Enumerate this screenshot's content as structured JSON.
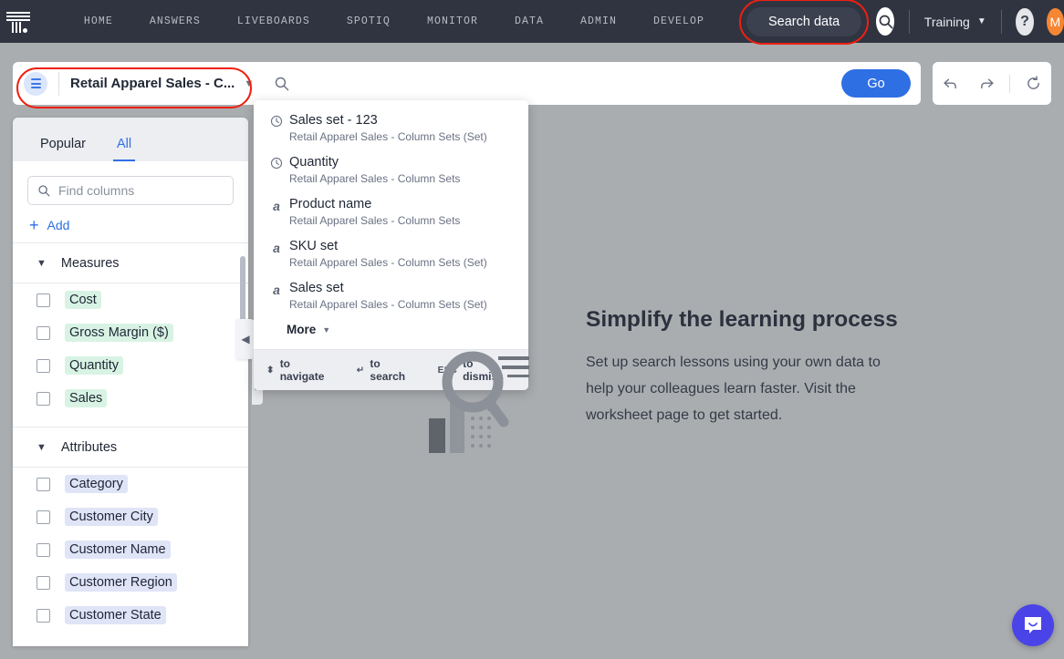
{
  "topnav": {
    "logo_name": "thoughtspot-logo",
    "links": [
      "HOME",
      "ANSWERS",
      "LIVEBOARDS",
      "SPOTIQ",
      "MONITOR",
      "DATA",
      "ADMIN",
      "DEVELOP"
    ],
    "search_data_button": "Search data",
    "search_icon": "search-icon",
    "org_label": "Training",
    "help_label": "?",
    "avatar_initial": "M",
    "highlight_color": "#f01f0f",
    "bar_color": "#2f3440"
  },
  "searchbar": {
    "dataset_label": "Retail Apparel Sales - C...",
    "dataset_icon": "columns-icon",
    "search_icon": "search-icon",
    "input_value": "",
    "input_placeholder": "",
    "go_label": "Go",
    "tools": [
      {
        "name": "undo-button",
        "glyph": "↩"
      },
      {
        "name": "redo-button",
        "glyph": "↪"
      },
      {
        "name": "reset-button",
        "glyph": "↻"
      }
    ]
  },
  "left_panel": {
    "tabs": [
      {
        "label": "Popular",
        "active": false
      },
      {
        "label": "All",
        "active": true
      }
    ],
    "find_placeholder": "Find columns",
    "find_value": "",
    "add_label": "Add",
    "sections": [
      {
        "title": "Measures",
        "kind": "measure",
        "expanded": true,
        "items": [
          "Cost",
          "Gross Margin ($)",
          "Quantity",
          "Sales"
        ]
      },
      {
        "title": "Attributes",
        "kind": "attribute",
        "expanded": true,
        "items": [
          "Category",
          "Customer City",
          "Customer Name",
          "Customer Region",
          "Customer State"
        ]
      }
    ],
    "measure_pill_color": "#d8f3e4",
    "attribute_pill_color": "#dfe4f7"
  },
  "suggestions": {
    "items": [
      {
        "icon": "clock-icon",
        "title": "Sales set - 123",
        "subtitle": "Retail Apparel Sales - Column Sets (Set)"
      },
      {
        "icon": "clock-icon",
        "title": "Quantity",
        "subtitle": "Retail Apparel Sales - Column Sets"
      },
      {
        "icon": "alpha-icon",
        "title": "Product name",
        "subtitle": "Retail Apparel Sales - Column Sets"
      },
      {
        "icon": "alpha-icon",
        "title": "SKU set",
        "subtitle": "Retail Apparel Sales - Column Sets (Set)"
      },
      {
        "icon": "alpha-icon",
        "title": "Sales set",
        "subtitle": "Retail Apparel Sales - Column Sets (Set)"
      }
    ],
    "more_label": "More",
    "footer": [
      {
        "key": "⬍",
        "label": "to navigate"
      },
      {
        "key": "↵",
        "label": "to search"
      },
      {
        "key": "ESC",
        "label": "to dismiss"
      }
    ]
  },
  "empty_state": {
    "illustration": "magnifier-illustration",
    "title": "Simplify the learning process",
    "body": "Set up search lessons using your own data to help your colleagues learn faster. Visit the worksheet page to get started."
  },
  "chat": {
    "name": "chat-bubble-button",
    "color": "#4a44e8"
  }
}
